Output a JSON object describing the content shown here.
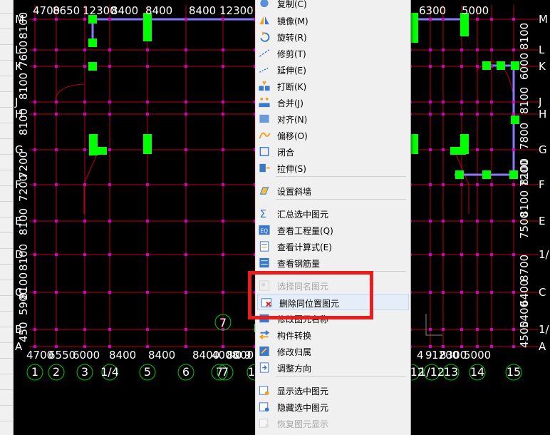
{
  "colors": {
    "grid": "#c00018",
    "axis_text": "#ffffff",
    "column": "#00ff00",
    "beam": "#8a7aff",
    "node": "#cc00cc",
    "menu_bg": "#f0f0f0",
    "highlight": "#e4edf8",
    "annotation": "#e81e1e"
  },
  "drawing": {
    "top_dims": [
      "4700",
      "8650",
      "12300",
      "8400",
      "8400",
      "8400",
      "12300",
      "6300",
      "5000"
    ],
    "bottom_dims": [
      "4700",
      "6550",
      "6000",
      "8400",
      "8400",
      "8400",
      "4008",
      "8000",
      "0",
      "9",
      "9",
      "4",
      "9",
      "1200",
      "8300",
      "5000"
    ],
    "left_dims": [
      "8100",
      "7600",
      "8100",
      "8100",
      "7200",
      "7200",
      "8100",
      "8100",
      "8100",
      "5900",
      "450"
    ],
    "right_dims": [
      "8100",
      "6000",
      "8100",
      "7800",
      "8100",
      "8100",
      "7500",
      "8700",
      "6400",
      "5400",
      "4500",
      "7200"
    ],
    "left_axes": [
      "M",
      "L",
      "K",
      "J",
      "H",
      "G",
      "F",
      "E",
      "D",
      "C",
      "B",
      "A"
    ],
    "right_axes": [
      "M",
      "L",
      "K",
      "J",
      "H",
      "G",
      "F",
      "E",
      "1/D",
      "C",
      "1/B",
      "A"
    ],
    "bottom_axes": [
      "1",
      "2",
      "3",
      "1/4",
      "5",
      "6",
      "7",
      "7",
      "11",
      "1/12",
      "1/12",
      "13",
      "14",
      "15"
    ],
    "floating_label": "7"
  },
  "menu": {
    "items": [
      {
        "label": "复制(C)",
        "icon": "copy-icon"
      },
      {
        "label": "镜像(M)",
        "icon": "mirror-icon"
      },
      {
        "label": "旋转(R)",
        "icon": "rotate-icon"
      },
      {
        "label": "修剪(T)",
        "icon": "trim-icon"
      },
      {
        "label": "延伸(E)",
        "icon": "extend-icon"
      },
      {
        "label": "打断(K)",
        "icon": "break-icon"
      },
      {
        "label": "合并(J)",
        "icon": "merge-icon"
      },
      {
        "label": "对齐(N)",
        "icon": "align-icon"
      },
      {
        "label": "偏移(O)",
        "icon": "offset-icon"
      },
      {
        "label": "闭合",
        "icon": "close-shape-icon"
      },
      {
        "label": "拉伸(S)",
        "icon": "stretch-icon"
      },
      {
        "label": "设置斜墙",
        "icon": "slant-wall-icon"
      },
      {
        "label": "汇总选中图元",
        "icon": "sum-icon"
      },
      {
        "label": "查看工程量(Q)",
        "icon": "quantity-icon"
      },
      {
        "label": "查看计算式(E)",
        "icon": "formula-icon"
      },
      {
        "label": "查看钢筋量",
        "icon": "rebar-icon"
      },
      {
        "label": "选择同名图元",
        "icon": "select-same-name-icon",
        "disabled": true
      },
      {
        "label": "删除同位置图元",
        "icon": "delete-same-position-icon",
        "highlighted": true
      },
      {
        "label": "修改图元名称",
        "icon": "rename-icon"
      },
      {
        "label": "构件转换",
        "icon": "convert-icon"
      },
      {
        "label": "修改归属",
        "icon": "ownership-icon"
      },
      {
        "label": "调整方向",
        "icon": "direction-icon"
      },
      {
        "label": "显示选中图元",
        "icon": "show-icon"
      },
      {
        "label": "隐藏选中图元",
        "icon": "hide-icon"
      },
      {
        "label": "恢复图元显示",
        "icon": "restore-icon",
        "disabled": true
      }
    ]
  }
}
